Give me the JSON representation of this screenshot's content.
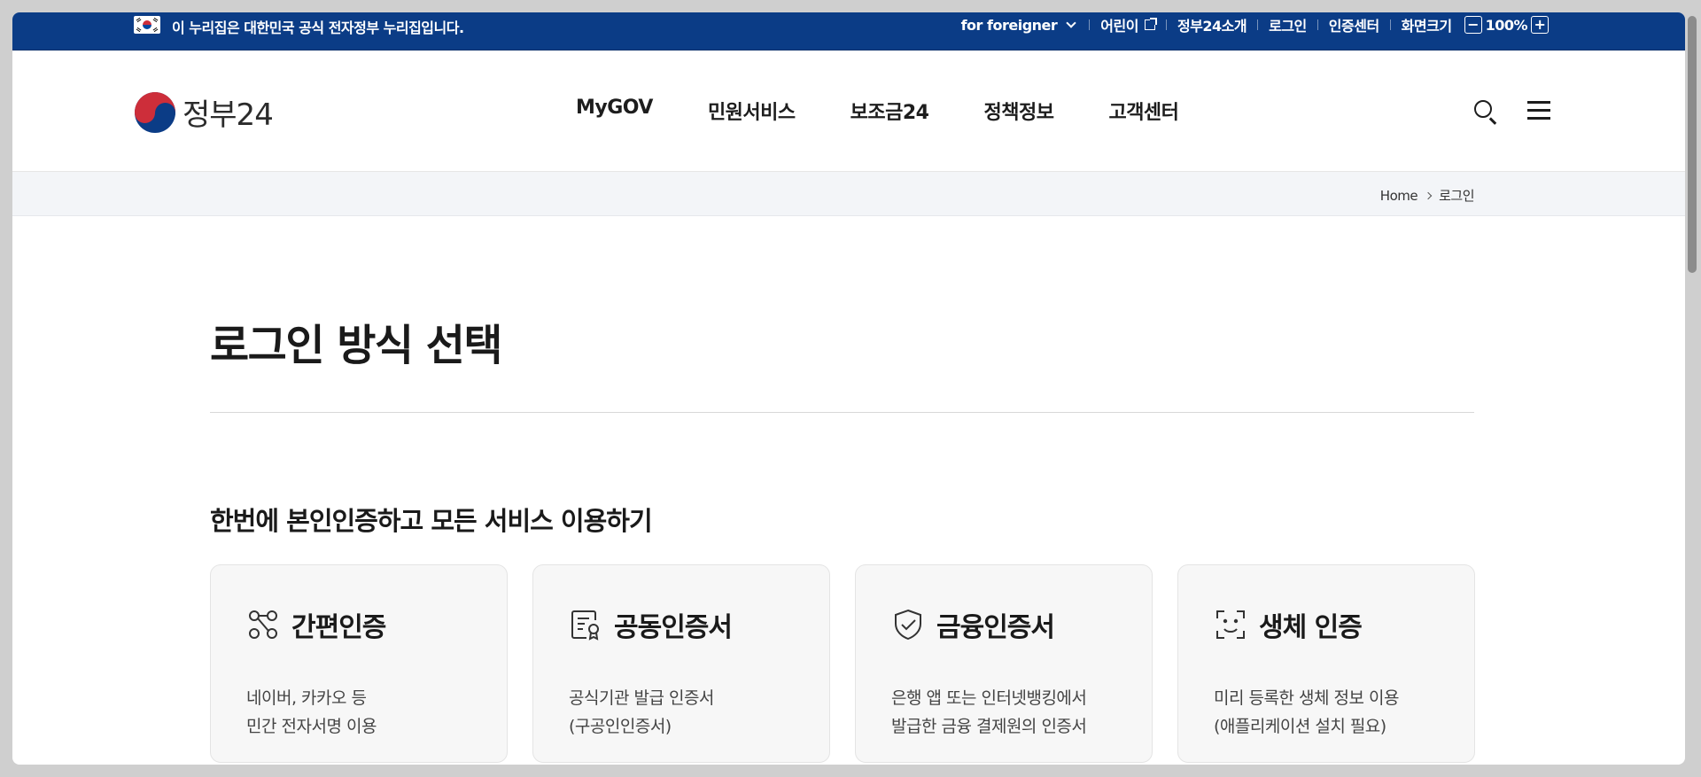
{
  "topbar": {
    "gov_notice": "이 누리집은 대한민국 공식 전자정부 누리집입니다.",
    "foreigner_label": "for foreigner",
    "kids_label": "어린이",
    "about_label": "정부24소개",
    "login_label": "로그인",
    "cert_center_label": "인증센터",
    "zoom_label": "화면크기",
    "zoom_minus": "−",
    "zoom_value": "100%",
    "zoom_plus": "+"
  },
  "header": {
    "logo_text": "정부24",
    "menu": [
      {
        "label": "MyGOV"
      },
      {
        "label": "민원서비스"
      },
      {
        "label": "보조금24"
      },
      {
        "label": "정책정보"
      },
      {
        "label": "고객센터"
      }
    ],
    "icons": {
      "search": "search-icon",
      "menu": "hamburger-menu-icon"
    }
  },
  "breadcrumb": {
    "home": "Home",
    "current": "로그인"
  },
  "main": {
    "title": "로그인 방식 선택",
    "section_title": "한번에 본인인증하고 모든 서비스 이용하기",
    "cards": [
      {
        "title": "간편인증",
        "icon": "simple-auth-icon",
        "desc1": "네이버, 카카오 등",
        "desc2": "민간 전자서명 이용"
      },
      {
        "title": "공동인증서",
        "icon": "certificate-icon",
        "desc1": "공식기관 발급 인증서",
        "desc2": "(구공인인증서)"
      },
      {
        "title": "금융인증서",
        "icon": "shield-check-icon",
        "desc1": "은행 앱 또는 인터넷뱅킹에서",
        "desc2": "발급한 금융 결제원의 인증서"
      },
      {
        "title": "생체 인증",
        "icon": "face-scan-icon",
        "desc1": "미리 등록한 생체 정보 이용",
        "desc2": "(애플리케이션 설치 필요)"
      }
    ]
  },
  "colors": {
    "topbar_bg": "#0b3c86",
    "card_bg": "#f7f7f7",
    "crumb_bg": "#f3f5f8"
  }
}
